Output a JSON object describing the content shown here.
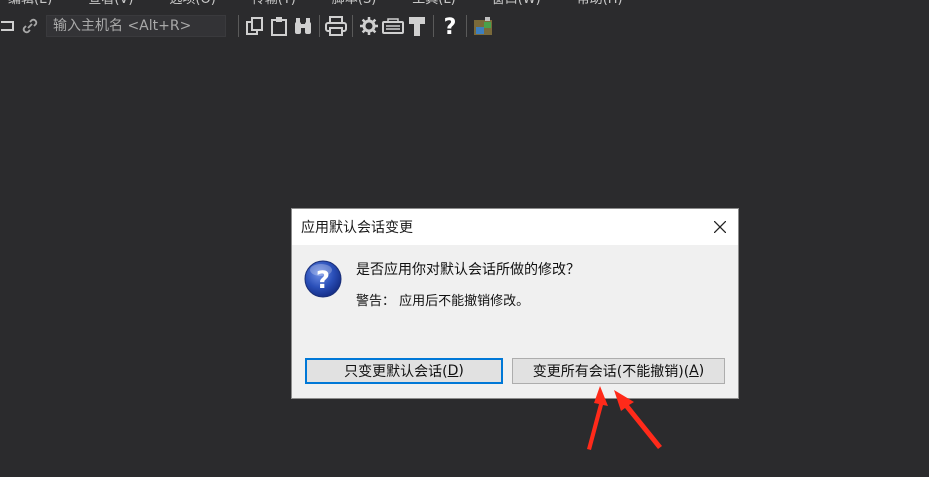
{
  "menu": {
    "items": [
      "编辑(E)",
      "查看(V)",
      "选项(O)",
      "传输(T)",
      "脚本(S)",
      "工具(L)",
      "窗口(W)",
      "帮助(H)"
    ]
  },
  "toolbar": {
    "host_placeholder": "输入主机名 <Alt+R>",
    "icons": [
      "reconnect-icon",
      "link-icon",
      "copy-icon",
      "paste-icon",
      "find-icon",
      "print-icon",
      "settings-icon",
      "keymap-icon",
      "tool-icon",
      "help-icon",
      "sftp-icon"
    ]
  },
  "dialog": {
    "title": "应用默认会话变更",
    "question": "是否应用你对默认会话所做的修改？",
    "warning": "警告： 应用后不能撤销修改。",
    "btn_default_label": "只变更默认会话(",
    "btn_default_key": "D",
    "btn_default_suffix": ")",
    "btn_all_label": "变更所有会话(不能撤销)(",
    "btn_all_key": "A",
    "btn_all_suffix": ")"
  },
  "colors": {
    "background": "#2b2b2d",
    "dialog_bg": "#f0f0f0",
    "default_button_border": "#0078d7",
    "annotation_arrow": "#ff2a1a"
  }
}
